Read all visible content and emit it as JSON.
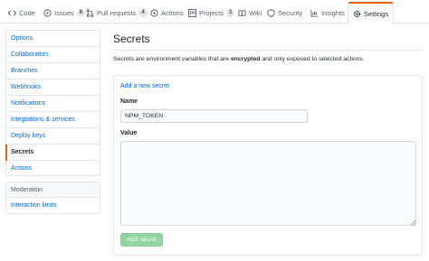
{
  "tabs": [
    {
      "label": "Code",
      "icon": "code-icon"
    },
    {
      "label": "Issues",
      "count": "6",
      "icon": "issue-icon"
    },
    {
      "label": "Pull requests",
      "count": "4",
      "icon": "pull-request-icon"
    },
    {
      "label": "Actions",
      "icon": "play-icon"
    },
    {
      "label": "Projects",
      "count": "1",
      "icon": "project-icon"
    },
    {
      "label": "Wiki",
      "icon": "book-icon"
    },
    {
      "label": "Security",
      "icon": "shield-icon"
    },
    {
      "label": "Insights",
      "icon": "graph-icon"
    },
    {
      "label": "Settings",
      "icon": "gear-icon",
      "selected": true
    }
  ],
  "sidebar": {
    "items": [
      {
        "label": "Options"
      },
      {
        "label": "Collaborators"
      },
      {
        "label": "Branches"
      },
      {
        "label": "Webhooks"
      },
      {
        "label": "Notifications"
      },
      {
        "label": "Integrations & services"
      },
      {
        "label": "Deploy keys"
      },
      {
        "label": "Secrets",
        "active": true
      },
      {
        "label": "Actions"
      }
    ],
    "moderation": {
      "heading": "Moderation",
      "items": [
        {
          "label": "Interaction limits"
        }
      ]
    }
  },
  "main": {
    "title": "Secrets",
    "description_pre": "Secrets are environment variables that are ",
    "description_bold": "encrypted",
    "description_post": " and only exposed to selected actions.",
    "add_link": "Add a new secret",
    "name_label": "Name",
    "name_value": "NPM_TOKEN",
    "value_label": "Value",
    "value_text": "",
    "submit_label": "Add secret"
  },
  "colors": {
    "link": "#0366d6",
    "accent": "#e36209",
    "button_disabled": "#94d3a2"
  }
}
